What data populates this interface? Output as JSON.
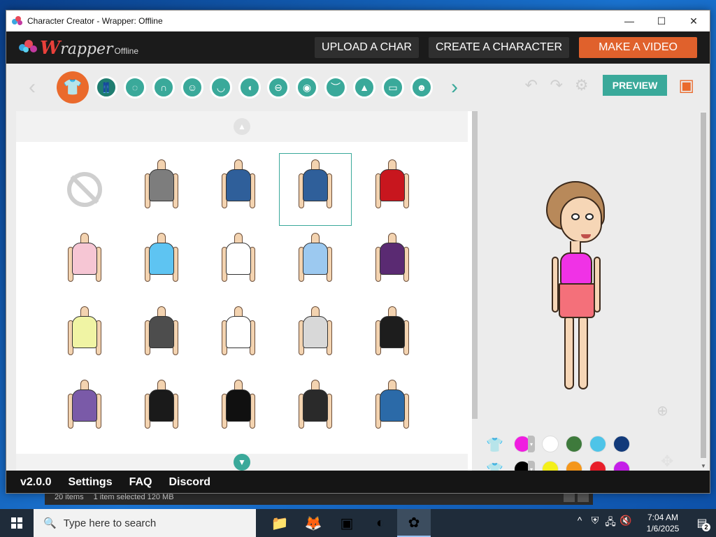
{
  "window": {
    "title": "Character Creator - Wrapper: Offline",
    "controls": {
      "minimize": "—",
      "maximize": "☐",
      "close": "✕"
    }
  },
  "header": {
    "logo_w": "W",
    "logo_rapper": "rapper",
    "logo_offline": "Offline",
    "upload_label": "UPLOAD A CHAR",
    "create_label": "CREATE A CHARACTER",
    "video_label": "MAKE A VIDEO"
  },
  "toolbar": {
    "prev_arrow": "‹",
    "next_arrow": "›",
    "categories": [
      {
        "name": "upper-body",
        "glyph": "👕"
      },
      {
        "name": "lower-body",
        "glyph": "👖"
      },
      {
        "name": "face-shape",
        "glyph": "◌"
      },
      {
        "name": "hair",
        "glyph": "∩"
      },
      {
        "name": "facial-hair",
        "glyph": "☺"
      },
      {
        "name": "mouth",
        "glyph": "◡"
      },
      {
        "name": "ear",
        "glyph": "◖"
      },
      {
        "name": "head",
        "glyph": "⊖"
      },
      {
        "name": "eyes",
        "glyph": "◉"
      },
      {
        "name": "eyebrows",
        "glyph": "︶"
      },
      {
        "name": "nose",
        "glyph": "▲"
      },
      {
        "name": "glasses",
        "glyph": "▭"
      },
      {
        "name": "skin",
        "glyph": "☻"
      }
    ],
    "undo": "↶",
    "redo": "↷",
    "settings": "⚙",
    "preview_label": "PREVIEW",
    "save": "▣"
  },
  "items": {
    "scroll_up": "▲",
    "scroll_down": "▼",
    "grid": [
      {
        "type": "none"
      },
      {
        "color": "#7d7d7d"
      },
      {
        "color": "#2f5f9a"
      },
      {
        "color": "#2f5f9a",
        "selected": true
      },
      {
        "color": "#c8161e"
      },
      {
        "color": "#f6c6d4"
      },
      {
        "color": "#5ec4f2"
      },
      {
        "color": "#ffffff"
      },
      {
        "color": "#9cc9f0"
      },
      {
        "color": "#5a2a72"
      },
      {
        "color": "#f0f4a4"
      },
      {
        "color": "#4d4d4d"
      },
      {
        "color": "#ffffff"
      },
      {
        "color": "#d8d8d8"
      },
      {
        "color": "#1d1d1d"
      },
      {
        "color": "#7a5aa8"
      },
      {
        "color": "#1a1a1a"
      },
      {
        "color": "#101010"
      },
      {
        "color": "#2a2a2a"
      },
      {
        "color": "#2b6aa8"
      }
    ]
  },
  "preview": {
    "zoom": "⊕",
    "move": "✥",
    "color_rows": [
      {
        "icon": "upper",
        "main": "#f01ee0",
        "swatches": [
          "#ffffff",
          "#3e7a3c",
          "#4ec4e8",
          "#123a7a"
        ]
      },
      {
        "icon": "lower",
        "main": "#000000",
        "swatches": [
          "#f4f01a",
          "#f4961a",
          "#e81e2a",
          "#c41ee8"
        ]
      }
    ],
    "scroll_down": "▼"
  },
  "footer": {
    "version": "v2.0.0",
    "settings": "Settings",
    "faq": "FAQ",
    "discord": "Discord"
  },
  "explorer_status": {
    "items": "20 items",
    "selected": "1 item selected  120 MB"
  },
  "taskbar": {
    "search_placeholder": "Type here to search",
    "apps": [
      "📁",
      "🦊",
      "▣",
      "◐",
      "✿"
    ],
    "tray": [
      "^",
      "⛨",
      "🖧",
      "🔇"
    ],
    "time": "7:04 AM",
    "date": "1/6/2025",
    "notifications": "2"
  }
}
